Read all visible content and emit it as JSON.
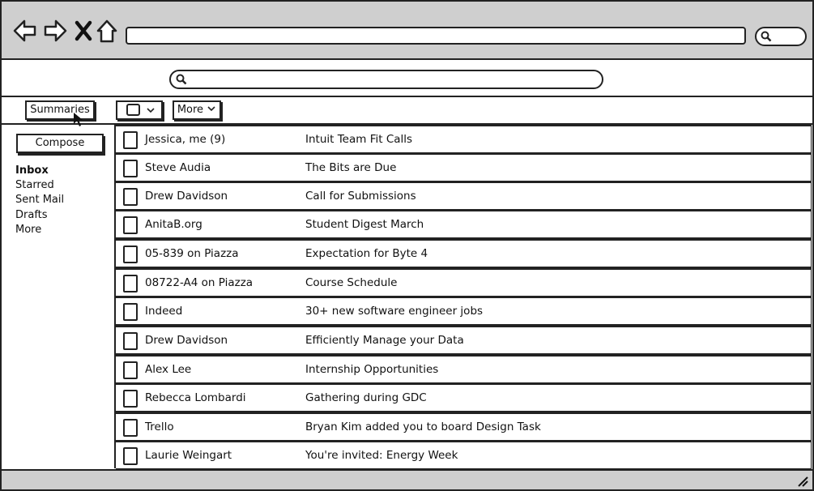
{
  "browser": {
    "nav_icons": [
      "back-arrow-icon",
      "forward-arrow-icon",
      "close-icon",
      "home-icon"
    ],
    "search_icon": "search-icon"
  },
  "toolbar": {
    "summaries_label": "Summaries",
    "select_icon": "checkbox-icon",
    "more_label": "More"
  },
  "sidebar": {
    "compose_label": "Compose",
    "folders": [
      {
        "label": "Inbox",
        "active": true
      },
      {
        "label": "Starred",
        "active": false
      },
      {
        "label": "Sent Mail",
        "active": false
      },
      {
        "label": "Drafts",
        "active": false
      },
      {
        "label": "More",
        "active": false
      }
    ]
  },
  "emails": [
    {
      "from": "Jessica, me (9)",
      "subject": "Intuit Team Fit Calls"
    },
    {
      "from": "Steve Audia",
      "subject": "The Bits are Due"
    },
    {
      "from": "Drew Davidson",
      "subject": "Call for Submissions"
    },
    {
      "from": "AnitaB.org",
      "subject": "Student Digest March"
    },
    {
      "from": "05-839 on Piazza",
      "subject": "Expectation for Byte 4"
    },
    {
      "from": "08722-A4 on Piazza",
      "subject": "Course Schedule"
    },
    {
      "from": "Indeed",
      "subject": "30+ new software engineer jobs"
    },
    {
      "from": "Drew Davidson",
      "subject": "Efficiently Manage your Data"
    },
    {
      "from": "Alex Lee",
      "subject": "Internship Opportunities"
    },
    {
      "from": "Rebecca Lombardi",
      "subject": "Gathering during GDC"
    },
    {
      "from": "Trello",
      "subject": "Bryan Kim added you to board Design Task"
    },
    {
      "from": "Laurie Weingart",
      "subject": "You're invited: Energy Week"
    }
  ]
}
